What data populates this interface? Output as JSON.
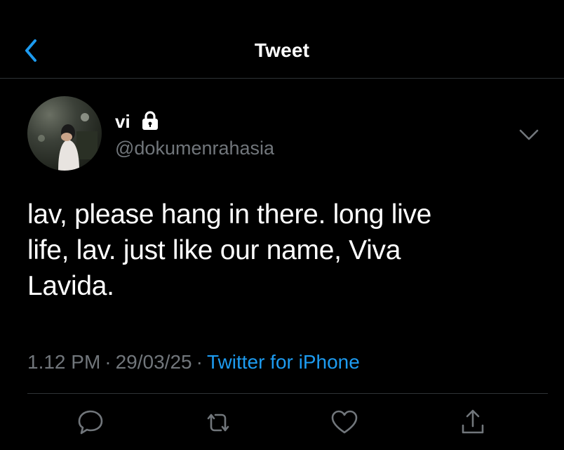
{
  "header": {
    "title": "Tweet",
    "back_icon": "chevron-left-icon"
  },
  "author": {
    "name": "vi",
    "handle": "@dokumenrahasia",
    "protected_icon": "lock-icon"
  },
  "tweet": {
    "lines": [
      "lav, please hang in there. long live",
      "life, lav. just like our name, Viva",
      "Lavida."
    ],
    "time": "1.12 PM",
    "date": "29/03/25",
    "separator": "·",
    "source": "Twitter for iPhone"
  },
  "actions": {
    "reply_icon": "reply-icon",
    "retweet_icon": "retweet-icon",
    "like_icon": "heart-icon",
    "share_icon": "share-icon"
  },
  "colors": {
    "background": "#000000",
    "text": "#ffffff",
    "muted": "#71767b",
    "accent": "#1d9bf0",
    "divider": "#2f3336"
  }
}
